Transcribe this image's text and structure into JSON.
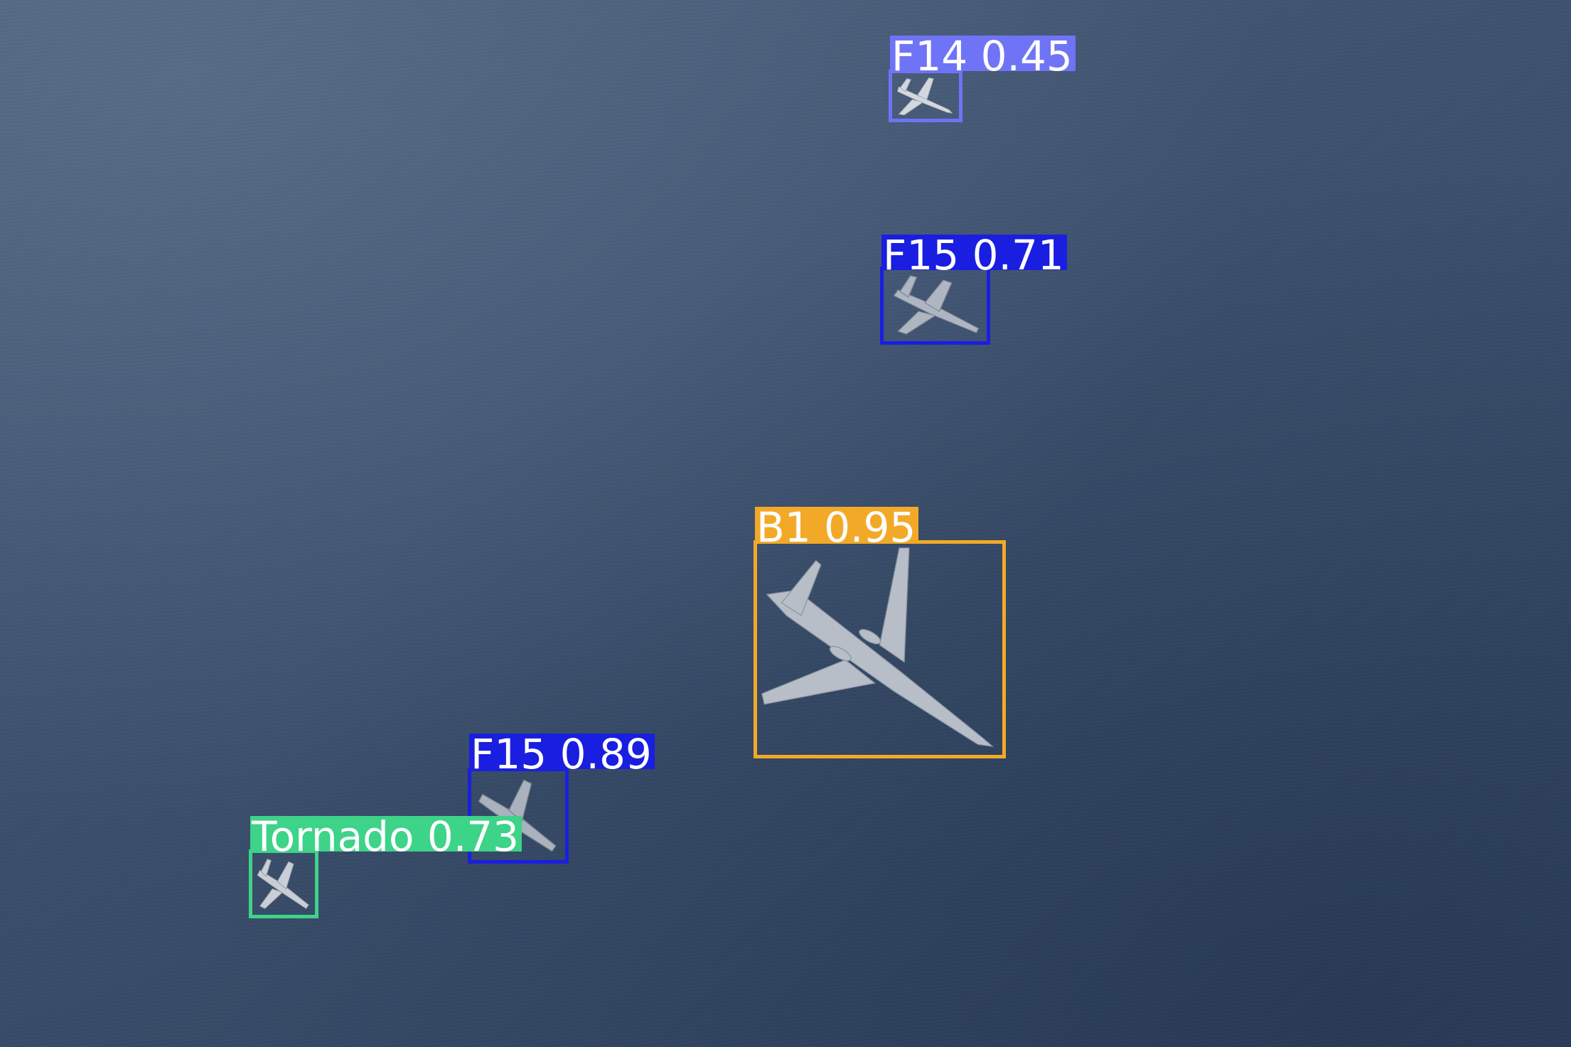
{
  "detections": [
    {
      "id": "f14",
      "label": "F14",
      "score": "0.45",
      "color": "#6f74f7",
      "text": "F14 0.45"
    },
    {
      "id": "f15a",
      "label": "F15",
      "score": "0.71",
      "color": "#1a1ee0",
      "text": "F15 0.71"
    },
    {
      "id": "b1",
      "label": "B1",
      "score": "0.95",
      "color": "#f3a928",
      "text": "B1 0.95"
    },
    {
      "id": "f15b",
      "label": "F15",
      "score": "0.89",
      "color": "#1a1ee0",
      "text": "F15 0.89"
    },
    {
      "id": "tornado",
      "label": "Tornado",
      "score": "0.73",
      "color": "#3dd389",
      "text": "Tornado 0.73"
    }
  ],
  "colors": {
    "sea": "#3c4f6c",
    "aircraft": "#c3c9d1"
  }
}
